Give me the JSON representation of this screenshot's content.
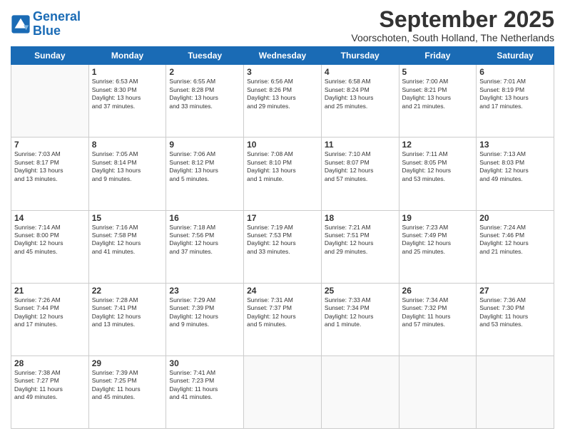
{
  "logo": {
    "text_general": "General",
    "text_blue": "Blue"
  },
  "header": {
    "month_title": "September 2025",
    "subtitle": "Voorschoten, South Holland, The Netherlands"
  },
  "weekdays": [
    "Sunday",
    "Monday",
    "Tuesday",
    "Wednesday",
    "Thursday",
    "Friday",
    "Saturday"
  ],
  "weeks": [
    [
      {
        "day": "",
        "info": ""
      },
      {
        "day": "1",
        "info": "Sunrise: 6:53 AM\nSunset: 8:30 PM\nDaylight: 13 hours\nand 37 minutes."
      },
      {
        "day": "2",
        "info": "Sunrise: 6:55 AM\nSunset: 8:28 PM\nDaylight: 13 hours\nand 33 minutes."
      },
      {
        "day": "3",
        "info": "Sunrise: 6:56 AM\nSunset: 8:26 PM\nDaylight: 13 hours\nand 29 minutes."
      },
      {
        "day": "4",
        "info": "Sunrise: 6:58 AM\nSunset: 8:24 PM\nDaylight: 13 hours\nand 25 minutes."
      },
      {
        "day": "5",
        "info": "Sunrise: 7:00 AM\nSunset: 8:21 PM\nDaylight: 13 hours\nand 21 minutes."
      },
      {
        "day": "6",
        "info": "Sunrise: 7:01 AM\nSunset: 8:19 PM\nDaylight: 13 hours\nand 17 minutes."
      }
    ],
    [
      {
        "day": "7",
        "info": "Sunrise: 7:03 AM\nSunset: 8:17 PM\nDaylight: 13 hours\nand 13 minutes."
      },
      {
        "day": "8",
        "info": "Sunrise: 7:05 AM\nSunset: 8:14 PM\nDaylight: 13 hours\nand 9 minutes."
      },
      {
        "day": "9",
        "info": "Sunrise: 7:06 AM\nSunset: 8:12 PM\nDaylight: 13 hours\nand 5 minutes."
      },
      {
        "day": "10",
        "info": "Sunrise: 7:08 AM\nSunset: 8:10 PM\nDaylight: 13 hours\nand 1 minute."
      },
      {
        "day": "11",
        "info": "Sunrise: 7:10 AM\nSunset: 8:07 PM\nDaylight: 12 hours\nand 57 minutes."
      },
      {
        "day": "12",
        "info": "Sunrise: 7:11 AM\nSunset: 8:05 PM\nDaylight: 12 hours\nand 53 minutes."
      },
      {
        "day": "13",
        "info": "Sunrise: 7:13 AM\nSunset: 8:03 PM\nDaylight: 12 hours\nand 49 minutes."
      }
    ],
    [
      {
        "day": "14",
        "info": "Sunrise: 7:14 AM\nSunset: 8:00 PM\nDaylight: 12 hours\nand 45 minutes."
      },
      {
        "day": "15",
        "info": "Sunrise: 7:16 AM\nSunset: 7:58 PM\nDaylight: 12 hours\nand 41 minutes."
      },
      {
        "day": "16",
        "info": "Sunrise: 7:18 AM\nSunset: 7:56 PM\nDaylight: 12 hours\nand 37 minutes."
      },
      {
        "day": "17",
        "info": "Sunrise: 7:19 AM\nSunset: 7:53 PM\nDaylight: 12 hours\nand 33 minutes."
      },
      {
        "day": "18",
        "info": "Sunrise: 7:21 AM\nSunset: 7:51 PM\nDaylight: 12 hours\nand 29 minutes."
      },
      {
        "day": "19",
        "info": "Sunrise: 7:23 AM\nSunset: 7:49 PM\nDaylight: 12 hours\nand 25 minutes."
      },
      {
        "day": "20",
        "info": "Sunrise: 7:24 AM\nSunset: 7:46 PM\nDaylight: 12 hours\nand 21 minutes."
      }
    ],
    [
      {
        "day": "21",
        "info": "Sunrise: 7:26 AM\nSunset: 7:44 PM\nDaylight: 12 hours\nand 17 minutes."
      },
      {
        "day": "22",
        "info": "Sunrise: 7:28 AM\nSunset: 7:41 PM\nDaylight: 12 hours\nand 13 minutes."
      },
      {
        "day": "23",
        "info": "Sunrise: 7:29 AM\nSunset: 7:39 PM\nDaylight: 12 hours\nand 9 minutes."
      },
      {
        "day": "24",
        "info": "Sunrise: 7:31 AM\nSunset: 7:37 PM\nDaylight: 12 hours\nand 5 minutes."
      },
      {
        "day": "25",
        "info": "Sunrise: 7:33 AM\nSunset: 7:34 PM\nDaylight: 12 hours\nand 1 minute."
      },
      {
        "day": "26",
        "info": "Sunrise: 7:34 AM\nSunset: 7:32 PM\nDaylight: 11 hours\nand 57 minutes."
      },
      {
        "day": "27",
        "info": "Sunrise: 7:36 AM\nSunset: 7:30 PM\nDaylight: 11 hours\nand 53 minutes."
      }
    ],
    [
      {
        "day": "28",
        "info": "Sunrise: 7:38 AM\nSunset: 7:27 PM\nDaylight: 11 hours\nand 49 minutes."
      },
      {
        "day": "29",
        "info": "Sunrise: 7:39 AM\nSunset: 7:25 PM\nDaylight: 11 hours\nand 45 minutes."
      },
      {
        "day": "30",
        "info": "Sunrise: 7:41 AM\nSunset: 7:23 PM\nDaylight: 11 hours\nand 41 minutes."
      },
      {
        "day": "",
        "info": ""
      },
      {
        "day": "",
        "info": ""
      },
      {
        "day": "",
        "info": ""
      },
      {
        "day": "",
        "info": ""
      }
    ]
  ]
}
